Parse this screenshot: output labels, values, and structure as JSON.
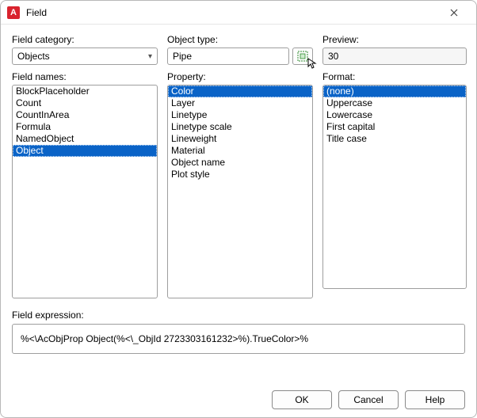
{
  "window": {
    "app_icon_letter": "A",
    "title": "Field"
  },
  "labels": {
    "field_category": "Field category:",
    "field_names": "Field names:",
    "object_type": "Object type:",
    "property": "Property:",
    "preview": "Preview:",
    "format": "Format:",
    "field_expression": "Field expression:"
  },
  "field_category": {
    "selected": "Objects"
  },
  "field_names": {
    "items": [
      "BlockPlaceholder",
      "Count",
      "CountInArea",
      "Formula",
      "NamedObject",
      "Object"
    ],
    "selected_index": 5
  },
  "object_type": {
    "value": "Pipe"
  },
  "property": {
    "items": [
      "Color",
      "Layer",
      "Linetype",
      "Linetype scale",
      "Lineweight",
      "Material",
      "Object name",
      "Plot style"
    ],
    "selected_index": 0
  },
  "preview": {
    "value": "30"
  },
  "format": {
    "items": [
      "(none)",
      "Uppercase",
      "Lowercase",
      "First capital",
      "Title case"
    ],
    "selected_index": 0
  },
  "expression": {
    "value": "%<\\AcObjProp Object(%<\\_ObjId 2723303161232>%).TrueColor>%"
  },
  "buttons": {
    "ok": "OK",
    "cancel": "Cancel",
    "help": "Help"
  }
}
